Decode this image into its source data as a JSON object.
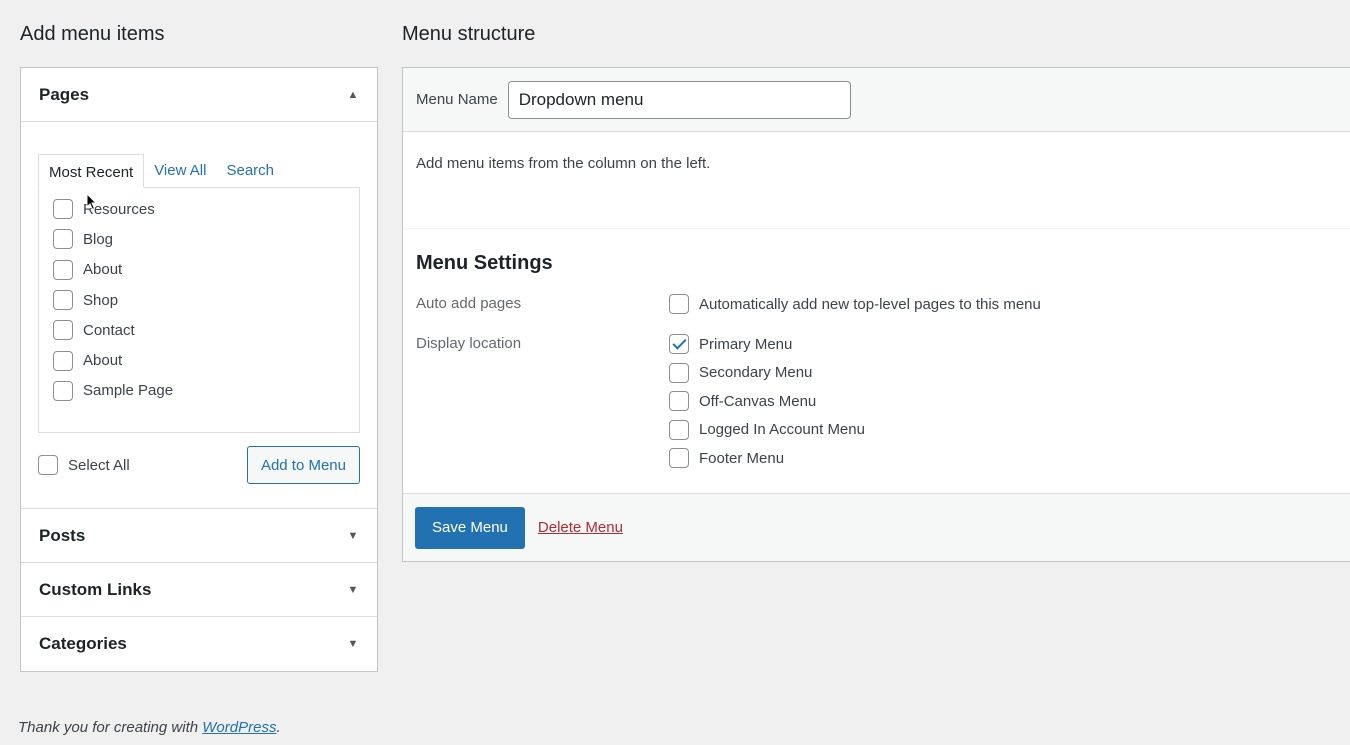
{
  "left": {
    "title": "Add menu items",
    "pages": {
      "title": "Pages",
      "tabs": [
        "Most Recent",
        "View All",
        "Search"
      ],
      "items": [
        "Resources",
        "Blog",
        "About",
        "Shop",
        "Contact",
        "About",
        "Sample Page"
      ],
      "select_all": "Select All",
      "add_button": "Add to Menu"
    },
    "posts": "Posts",
    "custom_links": "Custom Links",
    "categories": "Categories"
  },
  "right": {
    "title": "Menu structure",
    "menu_name_label": "Menu Name",
    "menu_name_value": "Dropdown menu",
    "hint": "Add menu items from the column on the left.",
    "settings_title": "Menu Settings",
    "auto_add_label": "Auto add pages",
    "auto_add_option": "Automatically add new top-level pages to this menu",
    "display_location_label": "Display location",
    "locations": [
      {
        "label": "Primary Menu",
        "checked": true
      },
      {
        "label": "Secondary Menu",
        "checked": false
      },
      {
        "label": "Off-Canvas Menu",
        "checked": false
      },
      {
        "label": "Logged In Account Menu",
        "checked": false
      },
      {
        "label": "Footer Menu",
        "checked": false
      }
    ],
    "save_button": "Save Menu",
    "delete_link": "Delete Menu"
  },
  "footer": {
    "text": "Thank you for creating with ",
    "link": "WordPress",
    "suffix": "."
  },
  "colors": {
    "accent": "#2271b1",
    "danger": "#b32d2e",
    "background": "#f0f0f1"
  }
}
